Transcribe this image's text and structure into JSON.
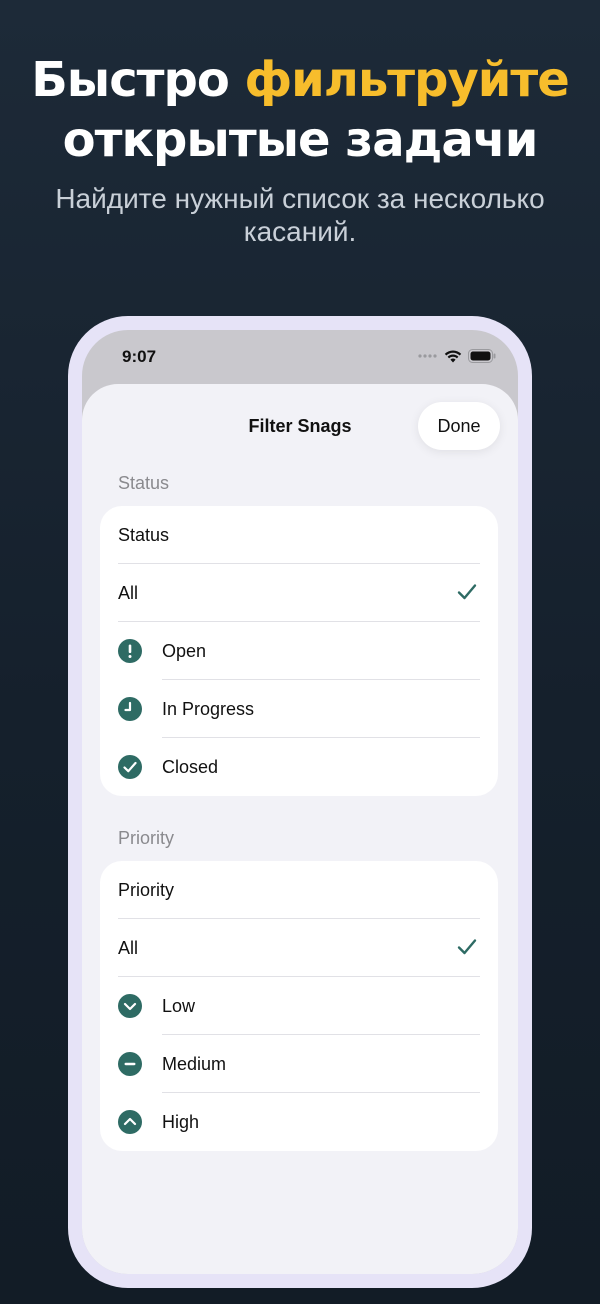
{
  "headline": {
    "part1": "Быстро ",
    "accent": "фильтруйте",
    "line2": "открытые задачи"
  },
  "subhead": "Найдите нужный список за несколько касаний.",
  "status_bar": {
    "time": "9:07"
  },
  "sheet": {
    "title": "Filter Snags",
    "done_label": "Done"
  },
  "status_section": {
    "header": "Status",
    "picker_label": "Status",
    "options": [
      {
        "label": "All",
        "icon": "none",
        "selected": true
      },
      {
        "label": "Open",
        "icon": "exclamation-circle-icon",
        "selected": false
      },
      {
        "label": "In Progress",
        "icon": "clock-circle-icon",
        "selected": false
      },
      {
        "label": "Closed",
        "icon": "checkmark-circle-icon",
        "selected": false
      }
    ]
  },
  "priority_section": {
    "header": "Priority",
    "picker_label": "Priority",
    "options": [
      {
        "label": "All",
        "icon": "none",
        "selected": true
      },
      {
        "label": "Low",
        "icon": "chevron-down-circle-icon",
        "selected": false
      },
      {
        "label": "Medium",
        "icon": "minus-circle-icon",
        "selected": false
      },
      {
        "label": "High",
        "icon": "chevron-up-circle-icon",
        "selected": false
      }
    ]
  },
  "colors": {
    "background": "#172330",
    "accent": "#f7bd2c",
    "icon_teal": "#2e6b64",
    "phone_frame": "#e6e3f7"
  }
}
